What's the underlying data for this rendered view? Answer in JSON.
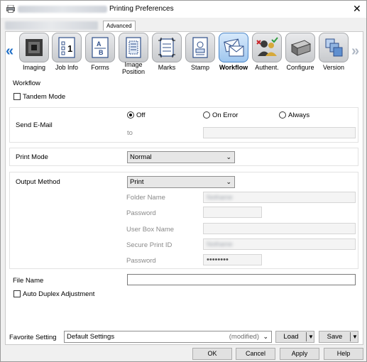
{
  "window": {
    "title": "Printing Preferences",
    "close_glyph": "✕"
  },
  "tabs": {
    "advanced_label": "Advanced"
  },
  "nav": {
    "left_arrow": "«",
    "right_arrow": "»"
  },
  "toolbar_icons": [
    {
      "label": "Imaging",
      "icon": "imaging-icon"
    },
    {
      "label": "Job Info",
      "icon": "job-info-icon"
    },
    {
      "label": "Forms",
      "icon": "forms-icon"
    },
    {
      "label": "Image Position",
      "line1": "Image",
      "line2": "Position",
      "icon": "image-position-icon"
    },
    {
      "label": "Marks",
      "icon": "marks-icon"
    },
    {
      "label": "Stamp",
      "icon": "stamp-icon"
    },
    {
      "label": "Workflow",
      "icon": "workflow-icon",
      "active": true
    },
    {
      "label": "Authent.",
      "icon": "authentication-icon"
    },
    {
      "label": "Configure",
      "icon": "configure-icon"
    },
    {
      "label": "Version",
      "icon": "version-icon"
    }
  ],
  "workflow": {
    "section_title": "Workflow",
    "tandem_mode": {
      "label": "Tandem Mode",
      "checked": false
    },
    "send_email": {
      "label": "Send E-Mail",
      "options": [
        "Off",
        "On Error",
        "Always"
      ],
      "selected": "Off",
      "to_label": "to",
      "to_value": ""
    },
    "print_mode": {
      "label": "Print Mode",
      "value": "Normal"
    },
    "output_method": {
      "label": "Output Method",
      "value": "Print",
      "folder_name_label": "Folder Name",
      "folder_name_value": "Nothame",
      "password_label": "Password",
      "password_value": "",
      "user_box_name_label": "User Box Name",
      "user_box_name_value": "",
      "secure_print_id_label": "Secure Print ID",
      "secure_print_id_value": "Nothame",
      "password2_label": "Password",
      "password2_value": "••••••••"
    },
    "file_name": {
      "label": "File Name",
      "value": ""
    },
    "auto_duplex": {
      "label": "Auto Duplex Adjustment",
      "checked": false
    }
  },
  "favorite": {
    "label": "Favorite Setting",
    "value": "Default Settings",
    "modified": "(modified)",
    "load_label": "Load",
    "save_label": "Save"
  },
  "footer": {
    "ok": "OK",
    "cancel": "Cancel",
    "apply": "Apply",
    "help": "Help"
  },
  "colors": {
    "accent": "#1f6fc7",
    "active_tile": "#9fc6ee"
  }
}
